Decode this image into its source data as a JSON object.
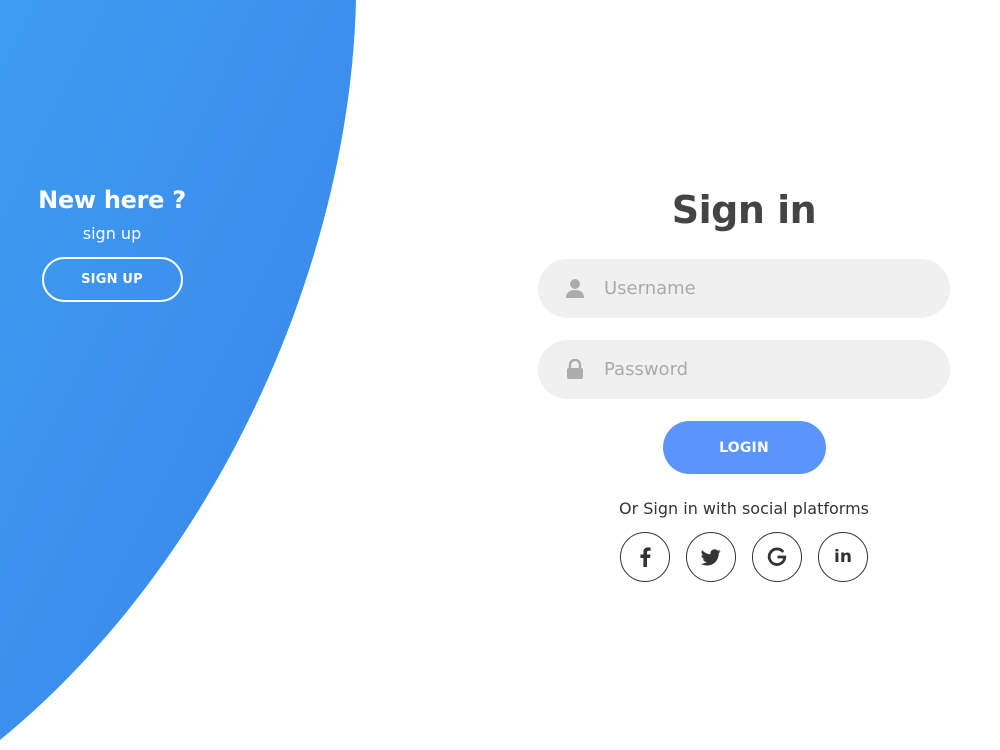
{
  "colors": {
    "panel_gradient_start": "#3d9cf0",
    "panel_gradient_end": "#3a84ea",
    "accent": "#5995fd",
    "title": "#444444",
    "field_bg": "#f0f0f0",
    "placeholder": "#aaaaaa"
  },
  "panel": {
    "title": "New here ?",
    "subtitle": "sign up",
    "signup_button_label": "SIGN UP"
  },
  "form": {
    "title": "Sign in",
    "username": {
      "placeholder": "Username",
      "value": "",
      "icon": "user-icon"
    },
    "password": {
      "placeholder": "Password",
      "value": "",
      "icon": "lock-icon"
    },
    "login_button_label": "LOGIN",
    "social_text": "Or Sign in with social platforms",
    "social": [
      {
        "name": "facebook",
        "icon": "facebook-icon"
      },
      {
        "name": "twitter",
        "icon": "twitter-icon"
      },
      {
        "name": "google",
        "icon": "google-icon"
      },
      {
        "name": "linkedin",
        "icon": "linkedin-icon",
        "glyph": "in"
      }
    ]
  }
}
